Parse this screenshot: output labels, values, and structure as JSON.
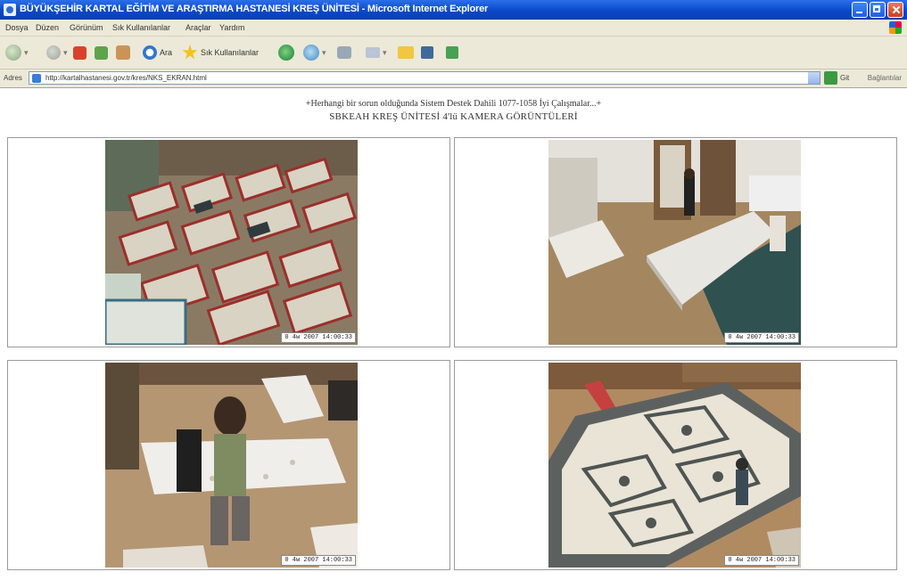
{
  "window": {
    "title": "BÜYÜKŞEHİR KARTAL EĞİTİM VE ARAŞTIRMA HASTANESİ KREŞ ÜNİTESİ - Microsoft Internet Explorer"
  },
  "menu": {
    "items": [
      "Dosya",
      "Düzen",
      "Görünüm",
      "Sık Kullanılanlar",
      "Araçlar",
      "Yardım"
    ]
  },
  "toolbar": {
    "back_icon": "back-arrow-icon",
    "search_label": "Ara",
    "favorites_label": "Sık Kullanılanlar"
  },
  "address": {
    "label": "Adres",
    "url": "http://kartalhastanesi.gov.tr/kres/NKS_EKRAN.html",
    "go_label": "Git",
    "links_label": "Bağlantılar"
  },
  "page": {
    "line1": "+Herhangi bir sorun olduğunda Sistem Destek Dahili 1077-1058 İyi Çalışmalar...+",
    "line2": "SBKEAH KREŞ ÜNİTESİ 4'lü KAMERA GÖRÜNTÜLERİ"
  },
  "cameras": [
    {
      "name": "Sleeping room with cribs",
      "stamp": "0  4w  2007 14:00:33"
    },
    {
      "name": "Activity room with tables",
      "stamp": "0  4w  2007 14:00:33"
    },
    {
      "name": "Dining area",
      "stamp": "0  4w  2007 14:00:33"
    },
    {
      "name": "Play room with carpet",
      "stamp": "0  4w  2007 14:00:33"
    }
  ],
  "colors": {
    "titlebar": "#0a48c8",
    "chrome": "#ece9d8",
    "floor": "#a88456"
  }
}
